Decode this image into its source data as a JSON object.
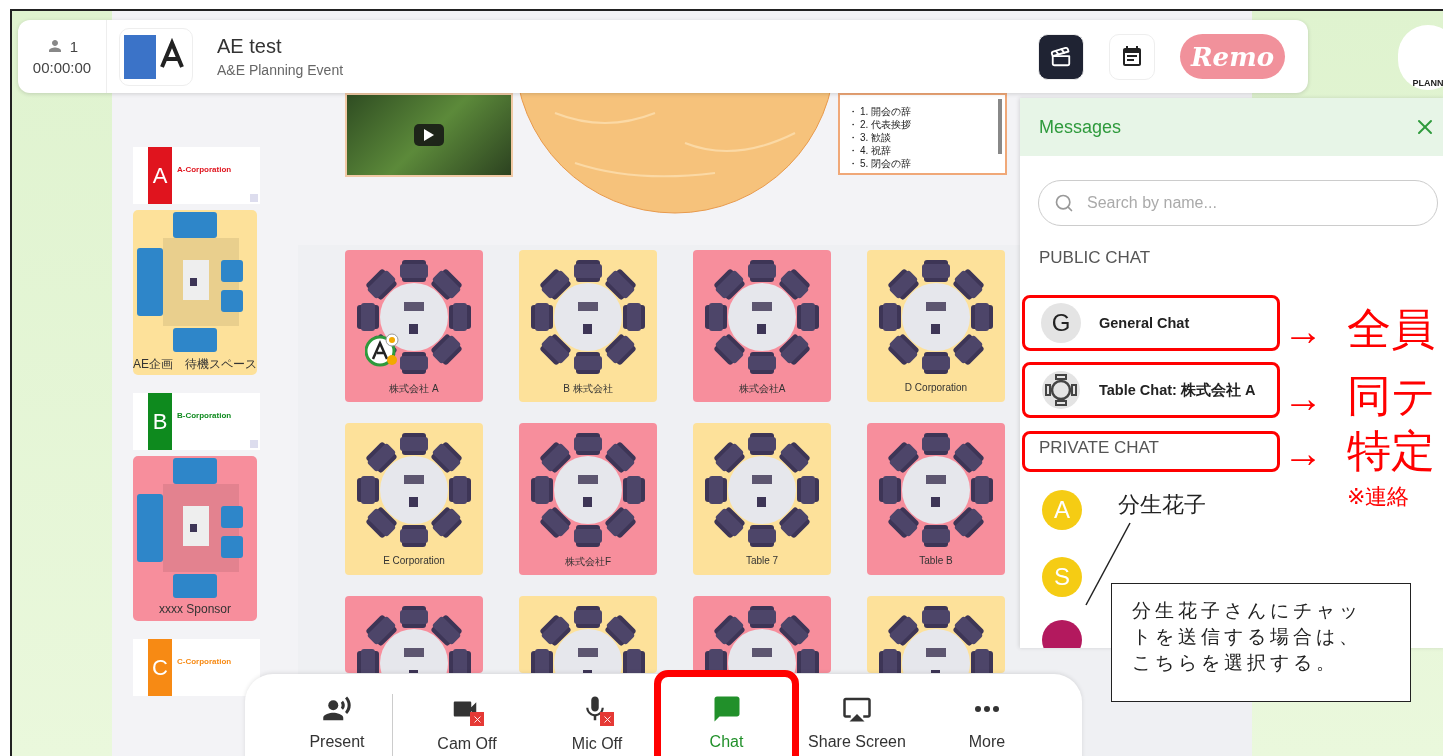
{
  "top_bar": {
    "attendee_count": "1",
    "timer": "00:00:00",
    "event_title": "AE test",
    "event_subtitle": "A&E Planning Event",
    "brand_logo_text": "Remo"
  },
  "corner_logo_text": "PLANN",
  "stage": {
    "agenda": [
      {
        "bullet": "・",
        "text": "1. 開会の辞"
      },
      {
        "bullet": "・",
        "text": "2. 代表挨拶"
      },
      {
        "bullet": "・",
        "text": "3. 歓談"
      },
      {
        "bullet": "・",
        "text": "4. 祝辞"
      },
      {
        "bullet": "・",
        "text": "5. 閉会の辞"
      }
    ]
  },
  "sponsors": [
    {
      "kind": "banner",
      "letter": "A",
      "name": "A-Corporation",
      "color": "#e0141e"
    },
    {
      "kind": "lounge",
      "label": "AE企画　待機スペース",
      "color": "#fde19a"
    },
    {
      "kind": "banner",
      "letter": "B",
      "name": "B-Corporation",
      "color": "#0e8a1e"
    },
    {
      "kind": "lounge",
      "label": "xxxx Sponsor",
      "color": "#f78e9c"
    },
    {
      "kind": "banner",
      "letter": "C",
      "name": "C-Corporation",
      "color": "#f78a14"
    }
  ],
  "tables": [
    {
      "label": "株式会社 A",
      "color": "#f78e9c",
      "has_attendee": true
    },
    {
      "label": "B 株式会社",
      "color": "#fde19a",
      "has_attendee": false
    },
    {
      "label": "株式会社A",
      "color": "#f78e9c",
      "has_attendee": false
    },
    {
      "label": "D Corporation",
      "color": "#fde19a",
      "has_attendee": false
    },
    {
      "label": "E Corporation",
      "color": "#fde19a",
      "has_attendee": false
    },
    {
      "label": "株式会社F",
      "color": "#f78e9c",
      "has_attendee": false
    },
    {
      "label": "Table 7",
      "color": "#fde19a",
      "has_attendee": false
    },
    {
      "label": "Table B",
      "color": "#f78e9c",
      "has_attendee": false
    },
    {
      "color": "#f78e9c",
      "has_attendee": false
    },
    {
      "color": "#fde19a",
      "has_attendee": false
    },
    {
      "color": "#f78e9c",
      "has_attendee": false
    },
    {
      "color": "#fde19a",
      "has_attendee": false
    }
  ],
  "messages": {
    "title": "Messages",
    "search": {
      "placeholder": "Search by name..."
    },
    "public_heading": "PUBLIC CHAT",
    "public_chats": [
      {
        "kind": "general",
        "avatar": "G",
        "name": "General Chat",
        "annotated": true
      },
      {
        "kind": "table",
        "name": "Table Chat: 株式会社 A",
        "annotated": true
      }
    ],
    "private_heading": {
      "text": "PRIVATE CHAT",
      "annotated": true
    },
    "contacts": [
      {
        "initial": "A",
        "color": "#f5cc14"
      },
      {
        "initial": "S",
        "color": "#f5cc14"
      },
      {
        "color": "#b3195e"
      }
    ]
  },
  "toolbar": [
    {
      "kind": "present",
      "label": "Present",
      "selected": false
    },
    {
      "kind": "camera",
      "label": "Cam Off",
      "selected": false
    },
    {
      "kind": "mic",
      "label": "Mic Off",
      "selected": false
    },
    {
      "kind": "chat",
      "label": "Chat",
      "selected": true,
      "annotated": true
    },
    {
      "kind": "share",
      "label": "Share Screen",
      "selected": false
    },
    {
      "kind": "more",
      "label": "More",
      "selected": false
    }
  ],
  "annotations": {
    "arrows": [
      {
        "arrow": "→",
        "text": "全員"
      },
      {
        "arrow": "→",
        "text": "同テ"
      },
      {
        "arrow": "→",
        "text": "特定"
      }
    ],
    "note": "※連絡",
    "name_label": "分生花子",
    "callout": "分生花子さんにチャットを送信する場合は、こちらを選択する。"
  }
}
